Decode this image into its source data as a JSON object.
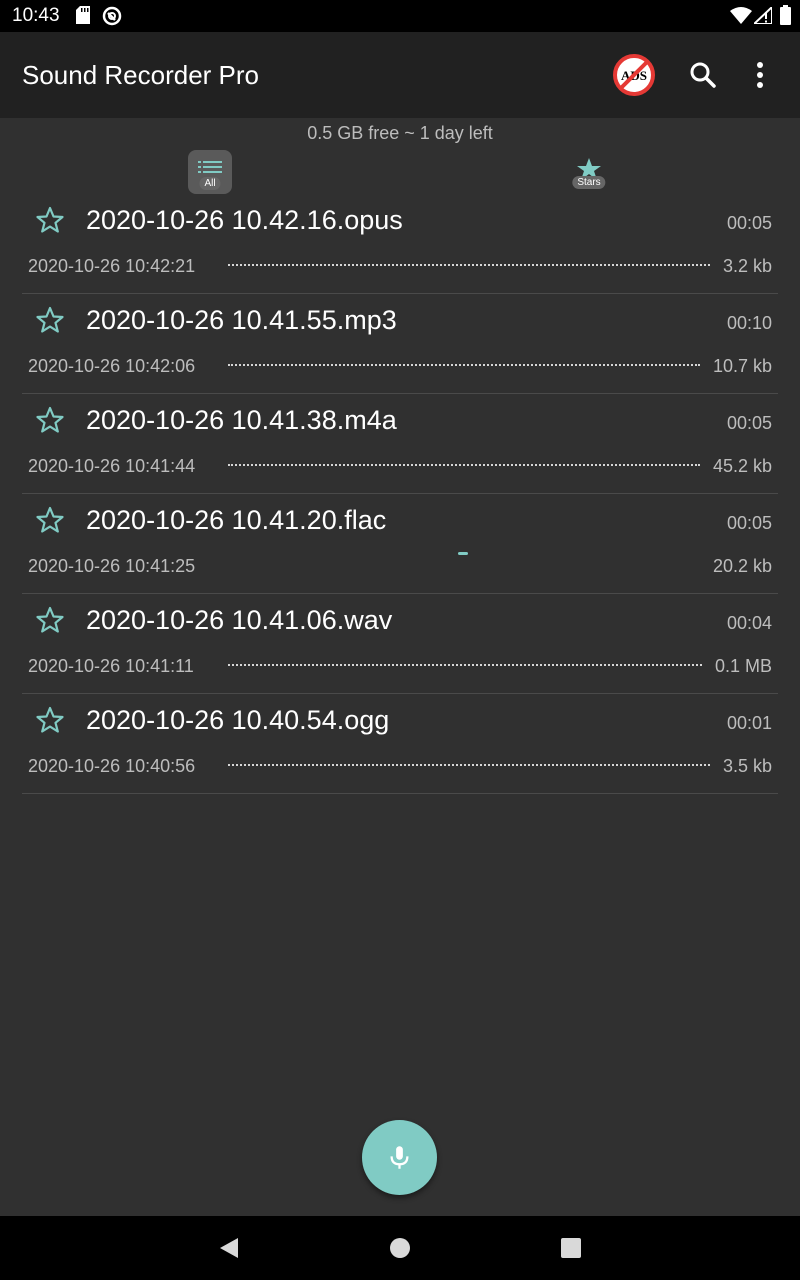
{
  "status_bar": {
    "time": "10:43",
    "icons": [
      "sd-card-icon",
      "sync-icon",
      "wifi-icon",
      "signal-icon",
      "battery-icon"
    ]
  },
  "app_bar": {
    "title": "Sound Recorder Pro",
    "actions": [
      "no-ads-icon",
      "search-icon",
      "overflow-menu-icon"
    ]
  },
  "storage_info": "0.5 GB free ~ 1 day left",
  "tabs": {
    "all_label": "All",
    "stars_label": "Stars"
  },
  "recordings": [
    {
      "name": "2020-10-26 10.42.16.opus",
      "duration": "00:05",
      "date": "2020-10-26 10:42:21",
      "size": "3.2 kb"
    },
    {
      "name": "2020-10-26 10.41.55.mp3",
      "duration": "00:10",
      "date": "2020-10-26 10:42:06",
      "size": "10.7 kb"
    },
    {
      "name": "2020-10-26 10.41.38.m4a",
      "duration": "00:05",
      "date": "2020-10-26 10:41:44",
      "size": "45.2 kb"
    },
    {
      "name": "2020-10-26 10.41.20.flac",
      "duration": "00:05",
      "date": "2020-10-26 10:41:25",
      "size": "20.2 kb"
    },
    {
      "name": "2020-10-26 10.41.06.wav",
      "duration": "00:04",
      "date": "2020-10-26 10:41:11",
      "size": "0.1 MB"
    },
    {
      "name": "2020-10-26 10.40.54.ogg",
      "duration": "00:01",
      "date": "2020-10-26 10:40:56",
      "size": "3.5 kb"
    }
  ],
  "colors": {
    "accent": "#80cbc4",
    "background": "#303030",
    "app_bar": "#212121",
    "ads_red": "#e53935"
  }
}
